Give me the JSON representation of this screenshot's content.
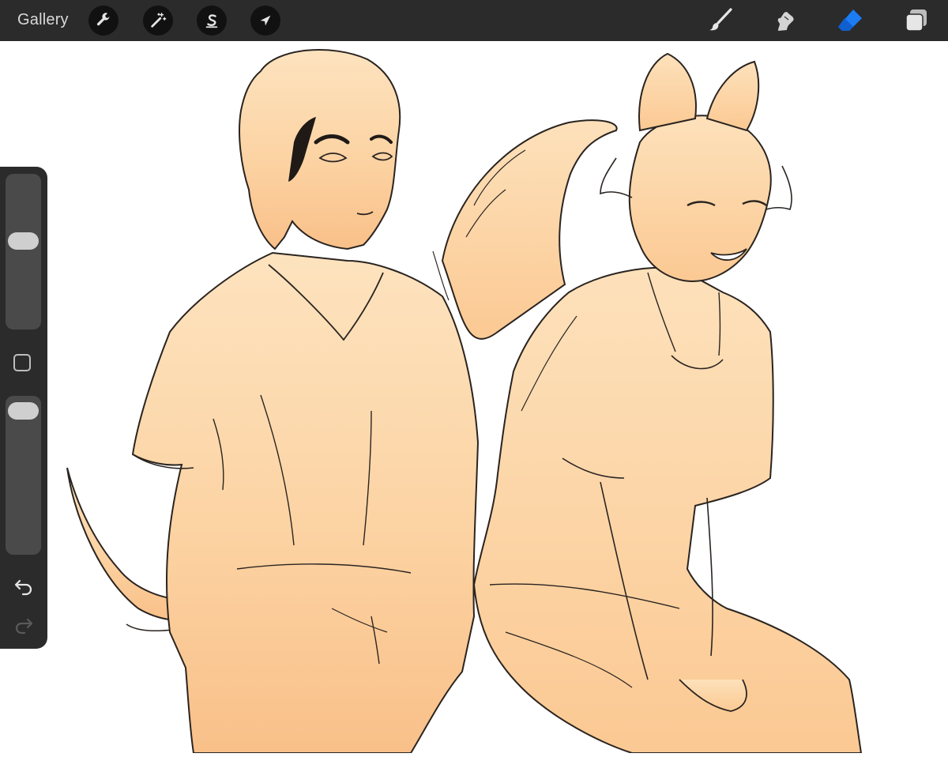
{
  "app": {
    "gallery_label": "Gallery"
  },
  "toolbar_left": [
    {
      "name": "actions-wrench-icon"
    },
    {
      "name": "adjustments-wand-icon"
    },
    {
      "name": "selection-s-icon"
    },
    {
      "name": "transform-arrow-icon"
    }
  ],
  "toolbar_right": [
    {
      "name": "brush-icon",
      "active": false
    },
    {
      "name": "smudge-icon",
      "active": false
    },
    {
      "name": "eraser-icon",
      "active": true
    },
    {
      "name": "layers-icon",
      "active": false
    }
  ],
  "sidebar": {
    "brush_size_fraction": 0.58,
    "opacity_fraction": 0.97
  },
  "colors": {
    "toolbar_bg": "#2b2b2b",
    "accent_blue": "#1c7cf4",
    "skin_fill_light": "#fde0b8",
    "skin_fill_dark": "#f9c38f",
    "line": "#2a2420"
  }
}
